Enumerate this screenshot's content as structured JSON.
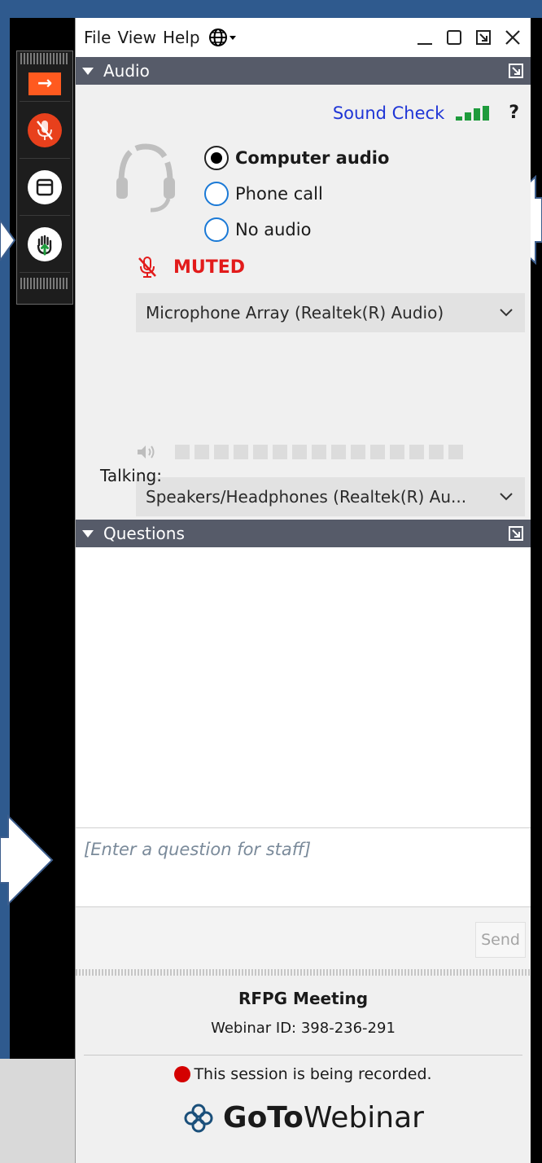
{
  "menu": {
    "file": "File",
    "view": "View",
    "help": "Help"
  },
  "audio_section": {
    "title": "Audio",
    "sound_check": "Sound Check",
    "help_symbol": "?",
    "options": [
      {
        "label": "Computer audio",
        "selected": true
      },
      {
        "label": "Phone call",
        "selected": false
      },
      {
        "label": "No audio",
        "selected": false
      }
    ],
    "status": "MUTED",
    "microphone_device": "Microphone Array (Realtek(R) Audio)",
    "speaker_device": "Speakers/Headphones  (Realtek(R)  Au...",
    "talking_label": "Talking:"
  },
  "questions_section": {
    "title": "Questions",
    "input_placeholder": "[Enter a question for staff]",
    "send_label": "Send"
  },
  "footer": {
    "meeting_name": "RFPG Meeting",
    "webinar_id": "Webinar ID: 398-236-291",
    "recording_notice": "This session is being recorded.",
    "brand_bold": "GoTo",
    "brand_regular": "Webinar"
  },
  "colors": {
    "header_bar": "#565b69",
    "muted_red": "#e21b1b",
    "link_blue": "#1f35d6",
    "level_green": "#1e9b3c",
    "control_orange": "#ff5a1f"
  }
}
